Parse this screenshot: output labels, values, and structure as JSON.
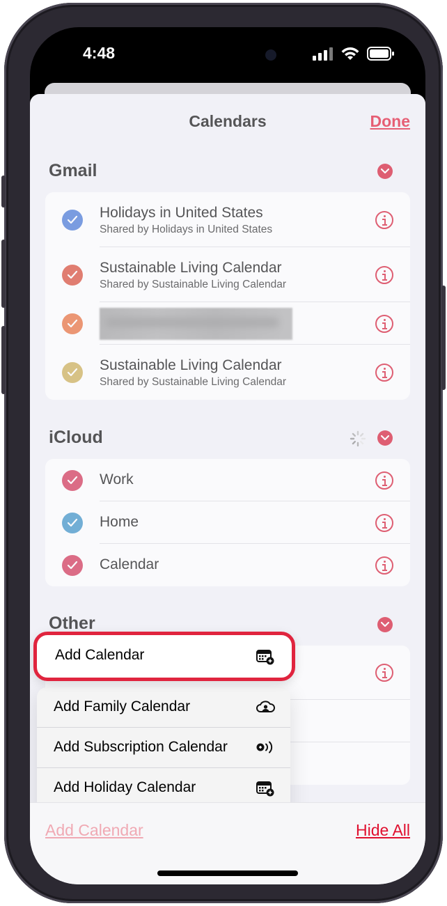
{
  "status_bar": {
    "time": "4:48"
  },
  "sheet": {
    "title": "Calendars",
    "done_label": "Done"
  },
  "sections": {
    "gmail": {
      "title": "Gmail",
      "items": [
        {
          "title": "Holidays in United States",
          "subtitle": "Shared by Holidays in United States",
          "color": "#3b6fd4"
        },
        {
          "title": "Sustainable Living Calendar",
          "subtitle": "Shared by Sustainable Living Calendar",
          "color": "#d8402a"
        },
        {
          "title": "",
          "subtitle": "",
          "color": "#e8662e",
          "redacted": true
        },
        {
          "title": "Sustainable Living Calendar",
          "subtitle": "Shared by Sustainable Living Calendar",
          "color": "#c9a94a"
        }
      ]
    },
    "icloud": {
      "title": "iCloud",
      "items": [
        {
          "title": "Work",
          "color": "#d0264a"
        },
        {
          "title": "Home",
          "color": "#2e8bc4"
        },
        {
          "title": "Calendar",
          "color": "#d0264a"
        }
      ]
    },
    "other": {
      "title": "Other"
    }
  },
  "menu": {
    "add_calendar": "Add Calendar",
    "add_family_calendar": "Add Family Calendar",
    "add_subscription_calendar": "Add Subscription Calendar",
    "add_holiday_calendar": "Add Holiday Calendar"
  },
  "bottom_bar": {
    "add_calendar_label": "Add Calendar",
    "hide_all_label": "Hide All"
  },
  "colors": {
    "accent_red": "#e0102f",
    "highlight_border": "#e0243e",
    "sheet_background": "#f2f2f7"
  }
}
